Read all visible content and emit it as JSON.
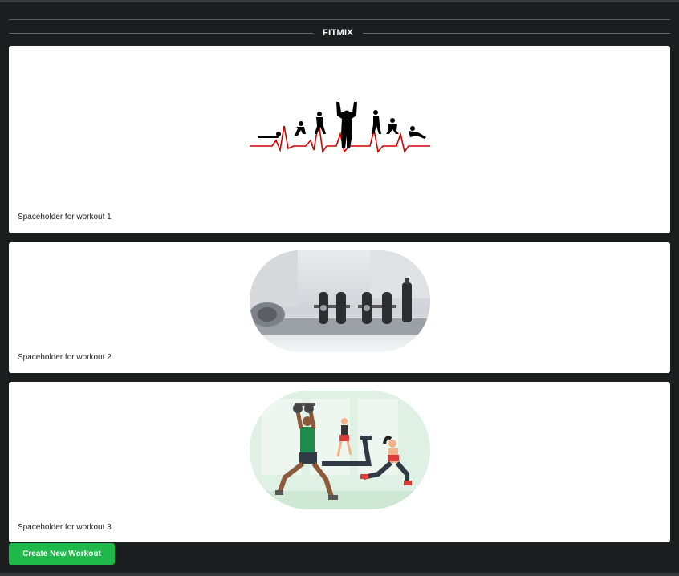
{
  "app": {
    "brand": "FITMIX"
  },
  "workouts": [
    {
      "caption": "Spaceholder for workout 1",
      "image_icon": "heartbeat-fitness-silhouettes-icon"
    },
    {
      "caption": "Spaceholder for workout 2",
      "image_icon": "dumbbells-photo-icon"
    },
    {
      "caption": "Spaceholder for workout 3",
      "image_icon": "gym-people-illustration-icon"
    }
  ],
  "actions": {
    "create_label": "Create New Workout"
  },
  "colors": {
    "background": "#1c1d1f",
    "card": "#ffffff",
    "accent_green": "#1fb84a",
    "heartbeat_red": "#d10000"
  }
}
